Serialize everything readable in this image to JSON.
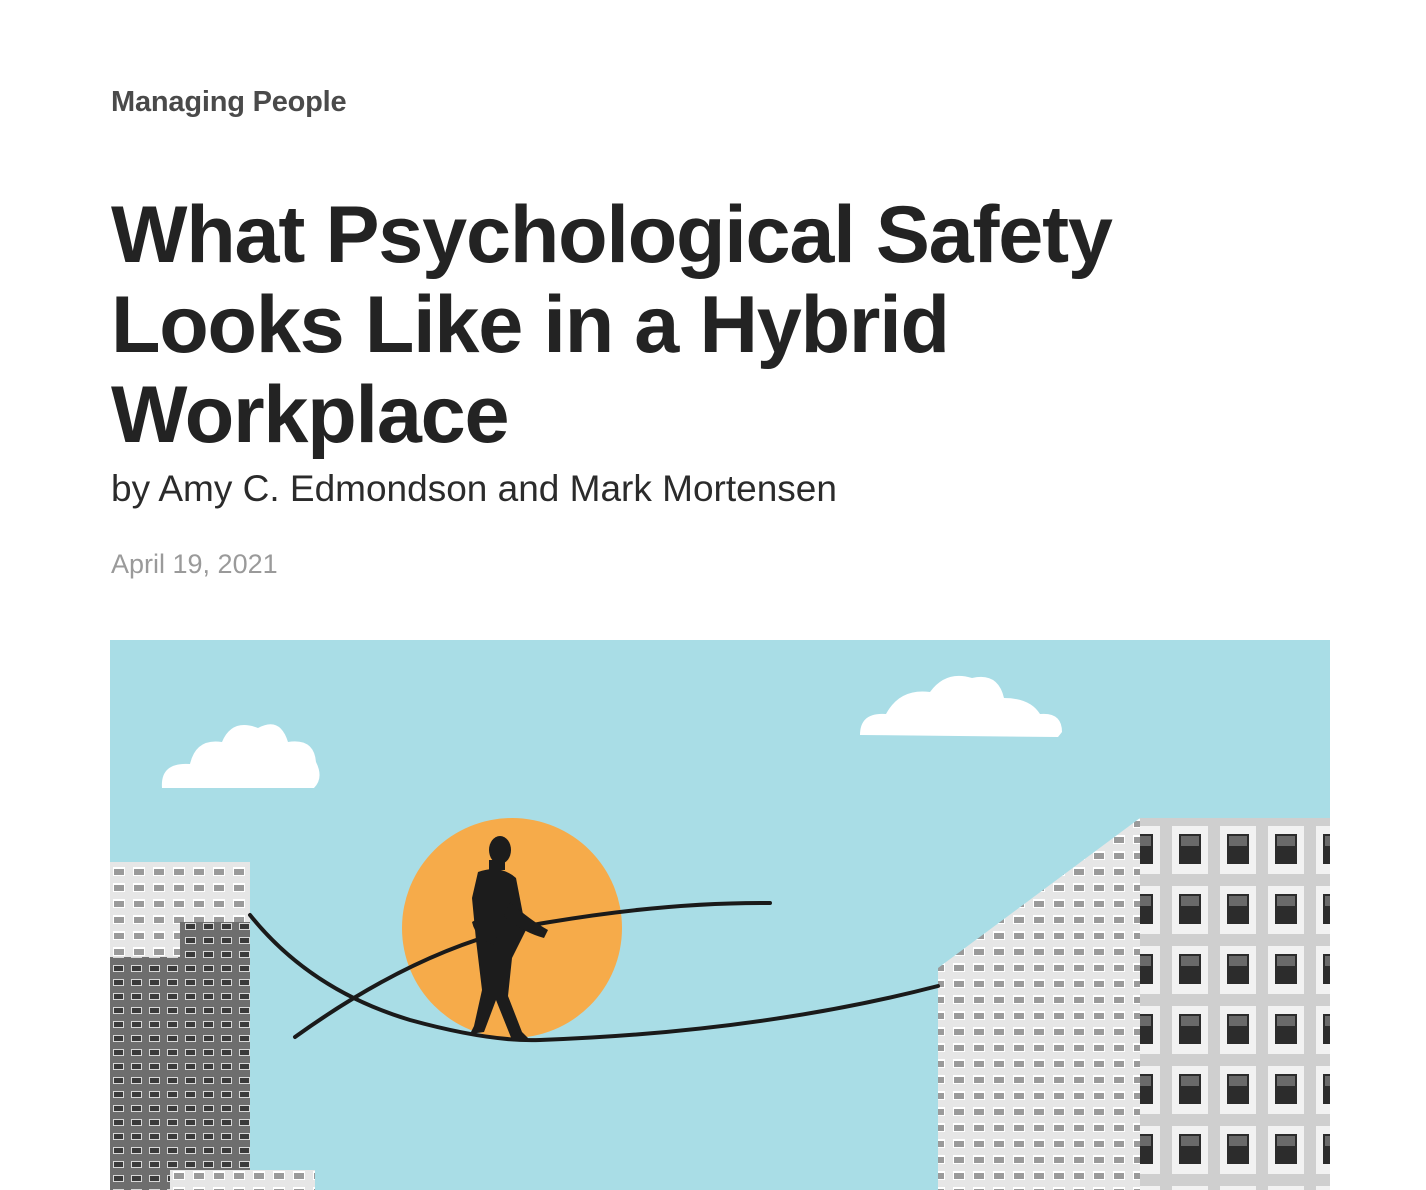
{
  "article": {
    "topic": "Managing People",
    "title_lines": [
      "What Psychological Safety",
      "Looks Like in a Hybrid",
      "Workplace"
    ],
    "byline_prefix": "by ",
    "author_1": "Amy C. Edmondson",
    "author_joiner": " and ",
    "author_2": "Mark Mortensen",
    "date": "April 19, 2021"
  },
  "hero_image": {
    "colors": {
      "sky": "#a9dde6",
      "sun": "#f6ab4a",
      "figure": "#1c1c1c",
      "cloud": "#ffffff"
    }
  }
}
